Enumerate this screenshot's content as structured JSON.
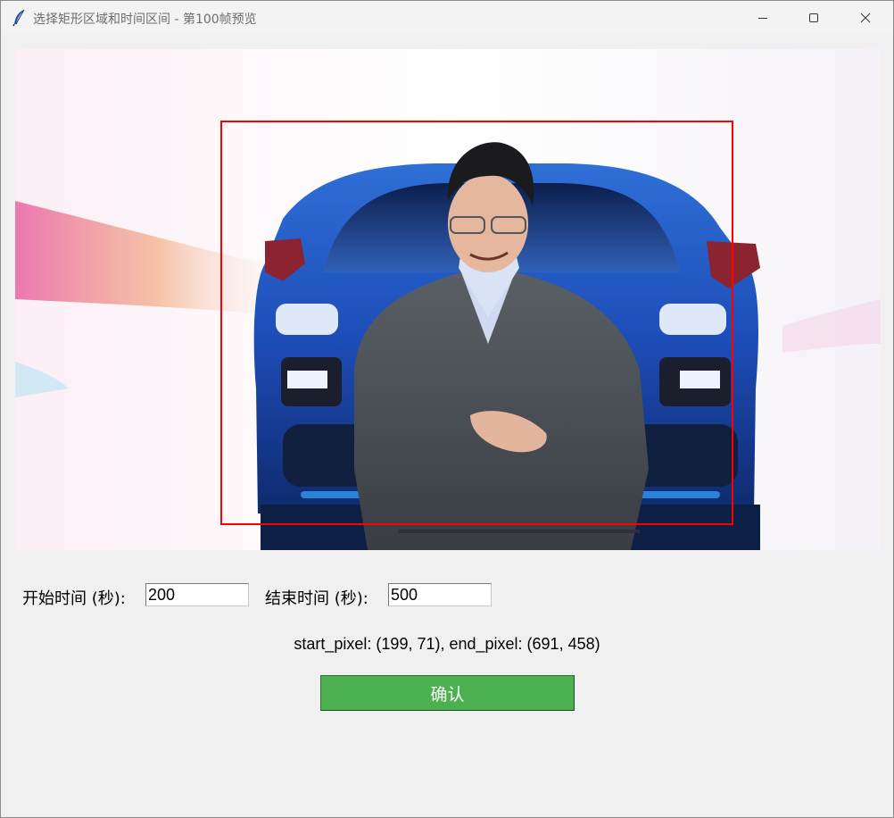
{
  "window": {
    "title": "选择矩形区域和时间区间 - 第100帧预览",
    "icons": [
      "feather-icon",
      "minimize-icon",
      "maximize-icon",
      "close-icon"
    ]
  },
  "preview": {
    "image_description_icon": "video-frame",
    "selection_color": "#ff0000"
  },
  "form": {
    "start_label": "开始时间 (秒):",
    "start_value": "200",
    "end_label": "结束时间 (秒):",
    "end_value": "500"
  },
  "status": {
    "pixel_text": "start_pixel: (199, 71), end_pixel: (691, 458)"
  },
  "actions": {
    "confirm_label": "确认",
    "confirm_color": "#4caf50"
  }
}
